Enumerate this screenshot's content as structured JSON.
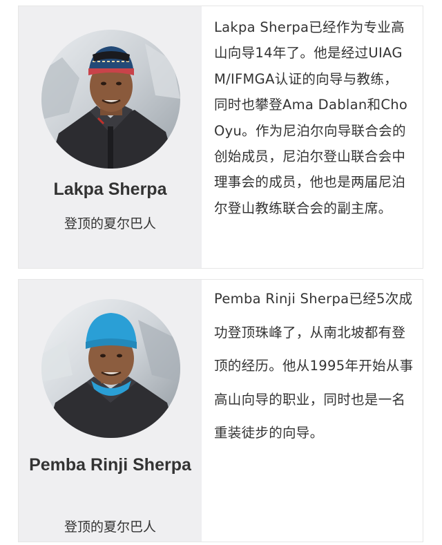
{
  "profiles": [
    {
      "name": "Lakpa Sherpa",
      "role": "登顶的夏尔巴人",
      "bio": "Lakpa Sherpa已经作为专业高山向导14年了。他是经过UIAGM/IFMGA认证的向导与教练，同时也攀登Ama Dablan和Cho Oyu。作为尼泊尔向导联合会的创始成员，尼泊尔登山联合会中理事会的成员，他也是两届尼泊尔登山教练联合会的副主席。"
    },
    {
      "name": "Pemba Rinji Sherpa",
      "role": "登顶的夏尔巴人",
      "bio": "Pemba Rinji Sherpa已经5次成功登顶珠峰了，从南北坡都有登顶的经历。他从1995年开始从事高山向导的职业，同时也是一名重装徒步的向导。"
    }
  ],
  "colors": {
    "left_panel_bg": "#efeff1",
    "text": "#333333",
    "border": "#e6e6e6",
    "hat_1": "#234a77",
    "hat_2": "#2a9fd6",
    "jacket": "#2c2c30"
  }
}
